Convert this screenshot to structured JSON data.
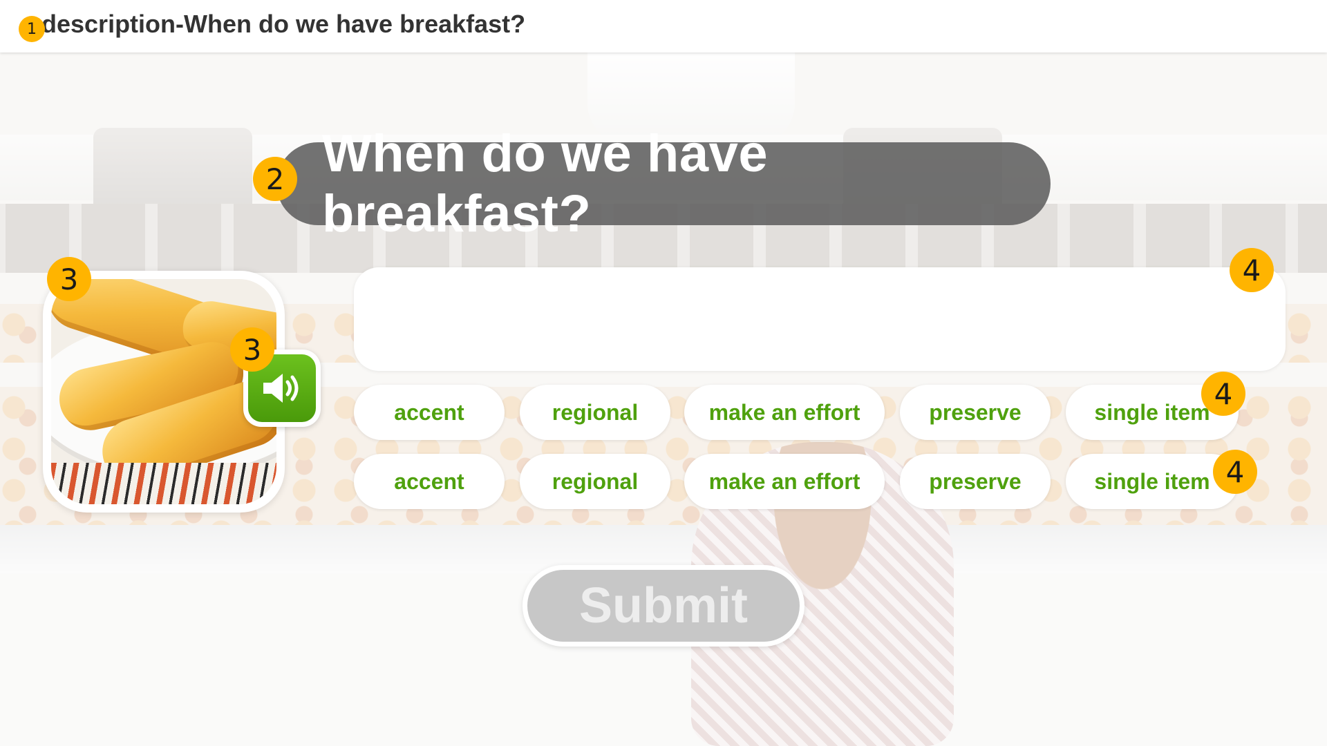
{
  "header": {
    "description": "description-When do we have breakfast?"
  },
  "question": {
    "text": "When do we have breakfast?"
  },
  "picture": {
    "alt": "bread rolls on a plate"
  },
  "audio": {
    "icon": "speaker-icon"
  },
  "answer": {
    "value": ""
  },
  "word_bank": {
    "rows": [
      [
        "accent",
        "regional",
        "make an effort",
        "preserve",
        "single item"
      ],
      [
        "accent",
        "regional",
        "make an effort",
        "preserve",
        "single item"
      ]
    ]
  },
  "submit": {
    "label": "Submit"
  },
  "badges": {
    "description": "1",
    "question": "2",
    "picture": "3",
    "audio": "3",
    "answer": "4",
    "row1": "4",
    "row2": "4"
  },
  "colors": {
    "accent_green": "#4fa10e",
    "badge_yellow": "#ffb400",
    "banner_gray": "#5f5f5f",
    "submit_disabled": "#c7c7c7"
  }
}
